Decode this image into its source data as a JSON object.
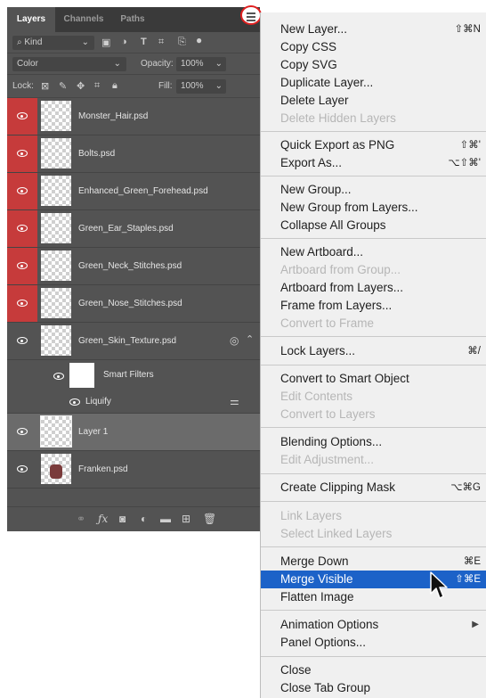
{
  "panel": {
    "tabs": [
      "Layers",
      "Channels",
      "Paths"
    ],
    "filter": {
      "kind": "Kind"
    },
    "blend_mode": "Color",
    "opacity_label": "Opacity:",
    "opacity_value": "100%",
    "lock_label": "Lock:",
    "fill_label": "Fill:",
    "fill_value": "100%",
    "layers": [
      {
        "name": "Monster_Hair.psd",
        "red_eye": true
      },
      {
        "name": "Bolts.psd",
        "red_eye": true
      },
      {
        "name": "Enhanced_Green_Forehead.psd",
        "red_eye": true
      },
      {
        "name": "Green_Ear_Staples.psd",
        "red_eye": true
      },
      {
        "name": "Green_Neck_Stitches.psd",
        "red_eye": true
      },
      {
        "name": "Green_Nose_Stitches.psd",
        "red_eye": true
      },
      {
        "name": "Green_Skin_Texture.psd",
        "red_eye": false
      }
    ],
    "smart_filters": "Smart Filters",
    "liquify": "Liquify",
    "layer1": "Layer 1",
    "franken": "Franken.psd"
  },
  "menu": {
    "items": [
      {
        "label": "New Layer...",
        "shortcut": "⇧⌘N",
        "disabled": false
      },
      {
        "label": "Copy CSS",
        "shortcut": "",
        "disabled": false
      },
      {
        "label": "Copy SVG",
        "shortcut": "",
        "disabled": false
      },
      {
        "label": "Duplicate Layer...",
        "shortcut": "",
        "disabled": false
      },
      {
        "label": "Delete Layer",
        "shortcut": "",
        "disabled": false
      },
      {
        "label": "Delete Hidden Layers",
        "shortcut": "",
        "disabled": true
      },
      {
        "label": "Quick Export as PNG",
        "shortcut": "⇧⌘'",
        "disabled": false
      },
      {
        "label": "Export As...",
        "shortcut": "⌥⇧⌘'",
        "disabled": false
      },
      {
        "label": "New Group...",
        "shortcut": "",
        "disabled": false
      },
      {
        "label": "New Group from Layers...",
        "shortcut": "",
        "disabled": false
      },
      {
        "label": "Collapse All Groups",
        "shortcut": "",
        "disabled": false
      },
      {
        "label": "New Artboard...",
        "shortcut": "",
        "disabled": false
      },
      {
        "label": "Artboard from Group...",
        "shortcut": "",
        "disabled": true
      },
      {
        "label": "Artboard from Layers...",
        "shortcut": "",
        "disabled": false
      },
      {
        "label": "Frame from Layers...",
        "shortcut": "",
        "disabled": false
      },
      {
        "label": "Convert to Frame",
        "shortcut": "",
        "disabled": true
      },
      {
        "label": "Lock Layers...",
        "shortcut": "⌘/",
        "disabled": false
      },
      {
        "label": "Convert to Smart Object",
        "shortcut": "",
        "disabled": false
      },
      {
        "label": "Edit Contents",
        "shortcut": "",
        "disabled": true
      },
      {
        "label": "Convert to Layers",
        "shortcut": "",
        "disabled": true
      },
      {
        "label": "Blending Options...",
        "shortcut": "",
        "disabled": false
      },
      {
        "label": "Edit Adjustment...",
        "shortcut": "",
        "disabled": true
      },
      {
        "label": "Create Clipping Mask",
        "shortcut": "⌥⌘G",
        "disabled": false
      },
      {
        "label": "Link Layers",
        "shortcut": "",
        "disabled": true
      },
      {
        "label": "Select Linked Layers",
        "shortcut": "",
        "disabled": true
      },
      {
        "label": "Merge Down",
        "shortcut": "⌘E",
        "disabled": false
      },
      {
        "label": "Merge Visible",
        "shortcut": "⇧⌘E",
        "disabled": false,
        "highlighted": true
      },
      {
        "label": "Flatten Image",
        "shortcut": "",
        "disabled": false
      },
      {
        "label": "Animation Options",
        "shortcut": "▶",
        "disabled": false
      },
      {
        "label": "Panel Options...",
        "shortcut": "",
        "disabled": false
      },
      {
        "label": "Close",
        "shortcut": "",
        "disabled": false
      },
      {
        "label": "Close Tab Group",
        "shortcut": "",
        "disabled": false
      }
    ]
  },
  "colors": {
    "panel_bg": "#535353",
    "visibility_red": "#c63b3b",
    "menu_highlight": "#1c62c8",
    "menu_button_ring": "#e02020"
  },
  "icons": [
    "menu-icon",
    "eye-icon",
    "link-icon",
    "fx-icon",
    "mask-icon",
    "adjustment-icon",
    "folder-icon",
    "new-layer-icon",
    "trash-icon",
    "pointer-cursor-icon"
  ]
}
